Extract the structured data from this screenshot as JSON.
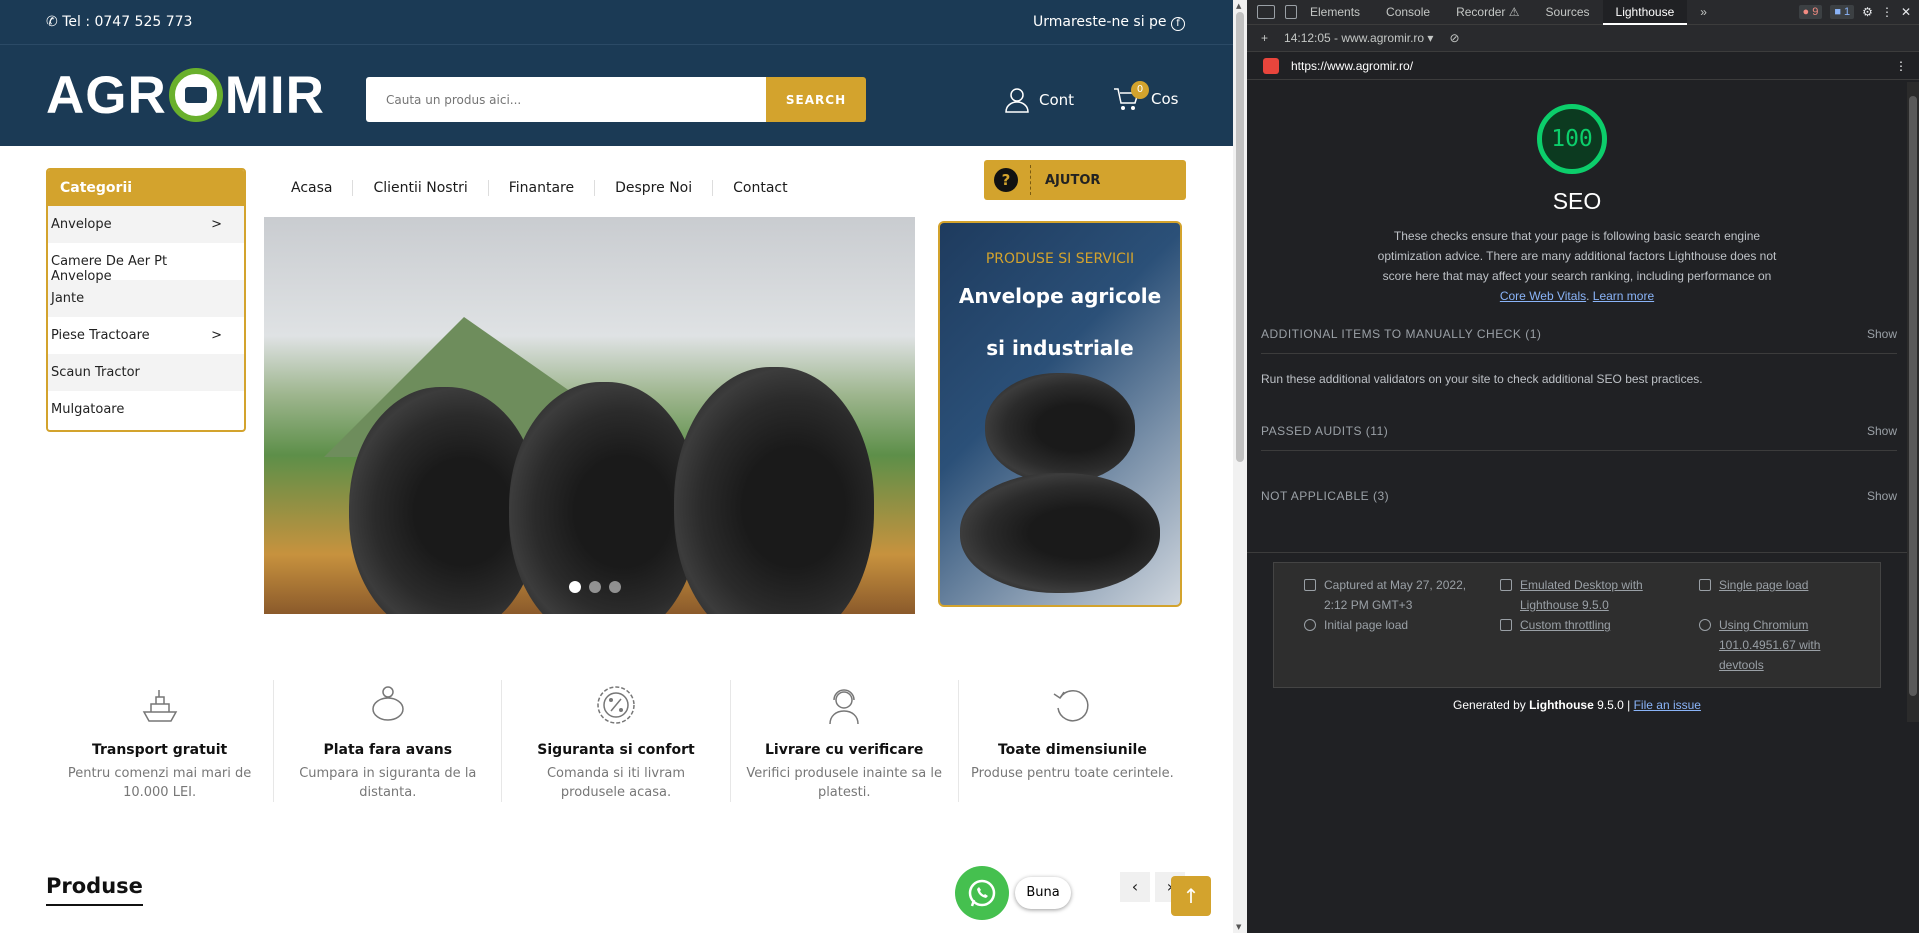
{
  "site": {
    "topbar": {
      "phone": "Tel : 0747 525 773",
      "follow": "Urmareste-ne si pe"
    },
    "logo": {
      "left": "AGR",
      "right": "MIR"
    },
    "search": {
      "placeholder": "Cauta un produs aici...",
      "button": "SEARCH"
    },
    "account": {
      "label": "Cont"
    },
    "cart": {
      "label": "Cos",
      "count": "0"
    },
    "categories": {
      "title": "Categorii",
      "items": [
        {
          "label": "Anvelope",
          "arrow": ">"
        },
        {
          "label": "Camere De Aer Pt Anvelope",
          "arrow": ""
        },
        {
          "label": "Jante",
          "arrow": ""
        },
        {
          "label": "Piese Tractoare",
          "arrow": ">"
        },
        {
          "label": "Scaun Tractor",
          "arrow": ""
        },
        {
          "label": "Mulgatoare",
          "arrow": ""
        }
      ]
    },
    "nav": [
      "Acasa",
      "Clientii Nostri",
      "Finantare",
      "Despre Noi",
      "Contact"
    ],
    "help": {
      "icon": "?",
      "label": "AJUTOR"
    },
    "promo": {
      "kicker": "PRODUSE SI SERVICII",
      "title_line1": "Anvelope agricole",
      "title_line2": "si industriale"
    },
    "features": [
      {
        "icon": "ship-icon",
        "title": "Transport gratuit",
        "desc": "Pentru comenzi mai mari de 10.000 LEI."
      },
      {
        "icon": "piggy-bank-icon",
        "title": "Plata fara avans",
        "desc": "Cumpara in siguranta de la distanta."
      },
      {
        "icon": "percent-icon",
        "title": "Siguranta si confort",
        "desc": "Comanda si iti livram produsele acasa."
      },
      {
        "icon": "support-icon",
        "title": "Livrare cu verificare",
        "desc": "Verifici produsele inainte sa le platesti."
      },
      {
        "icon": "refresh-icon",
        "title": "Toate dimensiunile",
        "desc": "Produse pentru toate cerintele."
      }
    ],
    "section_title": "Produse",
    "chat_bubble": "Buna",
    "carousel": {
      "prev": "‹",
      "next": "›"
    },
    "to_top": "↑"
  },
  "devtools": {
    "tabs": [
      "Elements",
      "Console",
      "Recorder ⚠",
      "Sources",
      "Lighthouse"
    ],
    "more": "»",
    "errors": "9",
    "messages": "1",
    "report_selector": "14:12:05 - www.agromir.ro",
    "url": "https://www.agromir.ro/",
    "score": "100",
    "category": "SEO",
    "description": "These checks ensure that your page is following basic search engine optimization advice. There are many additional factors Lighthouse does not score here that may affect your search ranking, including performance on",
    "link_vitals": "Core Web Vitals",
    "link_learn": "Learn more",
    "sections": [
      {
        "title": "ADDITIONAL ITEMS TO MANUALLY CHECK (1)",
        "action": "Show"
      },
      {
        "title": "PASSED AUDITS (11)",
        "action": "Show"
      },
      {
        "title": "NOT APPLICABLE (3)",
        "action": "Show"
      }
    ],
    "manual_desc": "Run these additional validators on your site to check additional SEO best practices.",
    "footer": {
      "captured": "Captured at May 27, 2022, 2:12 PM GMT+3",
      "load": "Initial page load",
      "emulated": "Emulated Desktop with Lighthouse 9.5.0",
      "throttling": "Custom throttling",
      "single": "Single page load",
      "chromium": "Using Chromium 101.0.4951.67 with devtools"
    },
    "generated_prefix": "Generated by",
    "generated_brand": "Lighthouse",
    "generated_version": "9.5.0 |",
    "file_issue": "File an issue"
  },
  "colors": {
    "navy": "#1b3a55",
    "gold": "#d3a32d",
    "green": "#69b02c",
    "lighthouse_green": "#0cce6b"
  }
}
